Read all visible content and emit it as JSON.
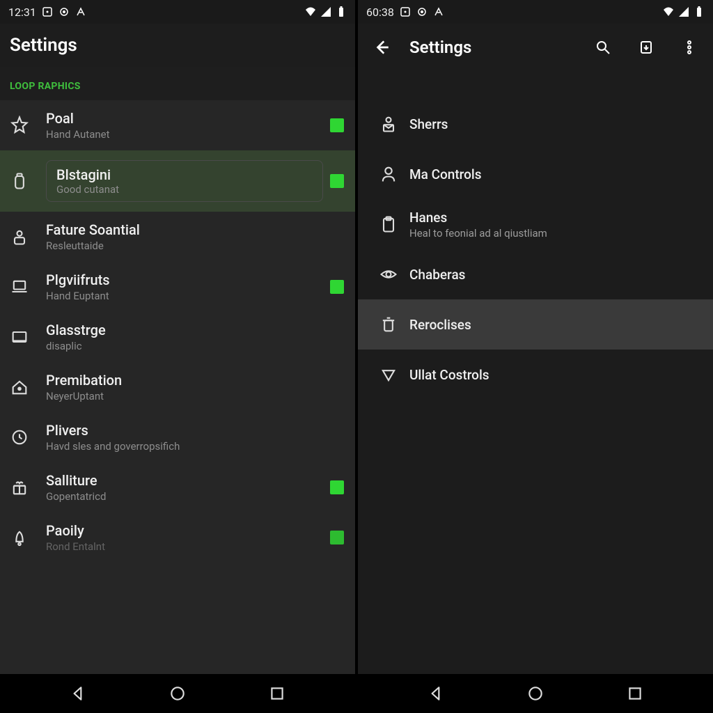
{
  "left": {
    "status": {
      "time": "12:31"
    },
    "header": {
      "title": "Settings"
    },
    "section_label": "LOOP RAPHICS",
    "items": [
      {
        "icon": "star",
        "primary": "Poal",
        "secondary": "Hand Autanet",
        "indicator": true,
        "selected": false,
        "pill": false
      },
      {
        "icon": "jar",
        "primary": "Blstagini",
        "secondary": "Good cutanat",
        "indicator": true,
        "selected": true,
        "pill": true
      },
      {
        "icon": "person-badge",
        "primary": "Fature Soantial",
        "secondary": "Resleuttaide",
        "indicator": false,
        "selected": false,
        "pill": false
      },
      {
        "icon": "laptop",
        "primary": "Plgviifruts",
        "secondary": "Hand Euptant",
        "indicator": true,
        "selected": false,
        "pill": false
      },
      {
        "icon": "rect-dash",
        "primary": "Glasstrge",
        "secondary": "disaplic",
        "indicator": false,
        "selected": false,
        "pill": false
      },
      {
        "icon": "home",
        "primary": "Premibation",
        "secondary": "NeyerUptant",
        "indicator": false,
        "selected": false,
        "pill": false
      },
      {
        "icon": "clock",
        "primary": "Plivers",
        "secondary": "Havd sles and goverropsifich",
        "indicator": false,
        "selected": false,
        "pill": false
      },
      {
        "icon": "gift",
        "primary": "Salliture",
        "secondary": "Gopentatricd",
        "indicator": true,
        "selected": false,
        "pill": false
      },
      {
        "icon": "bell",
        "primary": "Paoily",
        "secondary": "Rond Entalnt",
        "indicator": true,
        "selected": false,
        "pill": false
      }
    ]
  },
  "right": {
    "status": {
      "time": "60:38"
    },
    "header": {
      "title": "Settings"
    },
    "items": [
      {
        "icon": "person-mail",
        "primary": "Sherrs",
        "secondary": "",
        "selected": false
      },
      {
        "icon": "person",
        "primary": "Ma Controls",
        "secondary": "",
        "selected": false
      },
      {
        "icon": "clipboard",
        "primary": "Hanes",
        "secondary": "Heal to feonial ad al qiustliam",
        "selected": false
      },
      {
        "icon": "eye",
        "primary": "Chaberas",
        "secondary": "",
        "selected": false
      },
      {
        "icon": "trash",
        "primary": "Reroclises",
        "secondary": "",
        "selected": true
      },
      {
        "icon": "triangle-down",
        "primary": "Ullat Costrols",
        "secondary": "",
        "selected": false
      }
    ]
  }
}
